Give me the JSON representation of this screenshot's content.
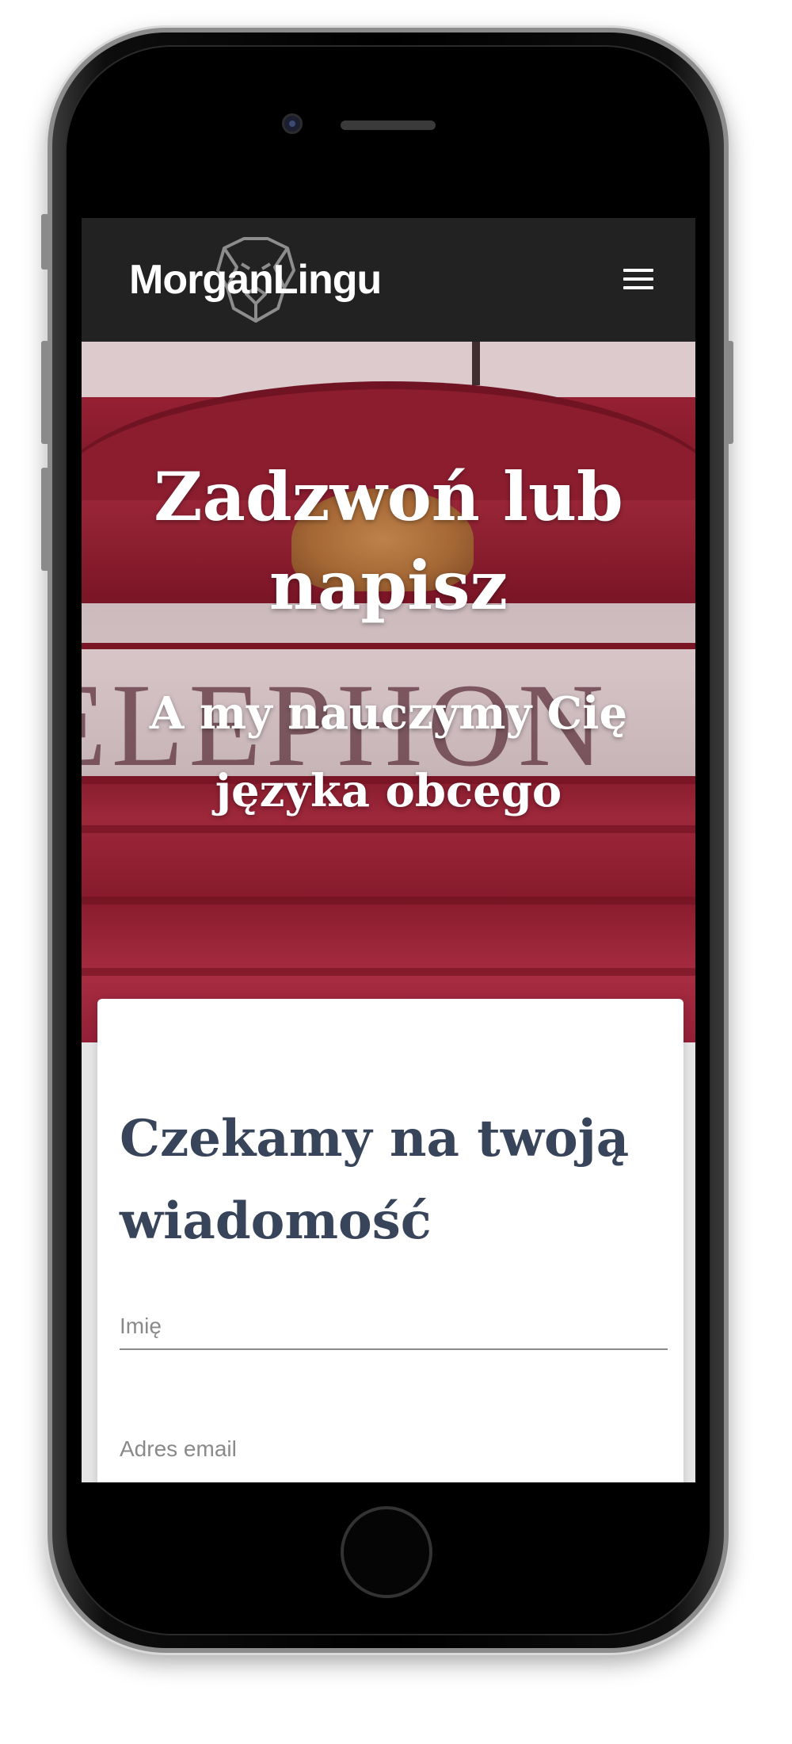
{
  "header": {
    "logo_text": "MorganLingu",
    "menu_icon": "hamburger-menu-icon"
  },
  "hero": {
    "title": "Zadzwoń lub napisz",
    "subtitle": "A my nauczymy Cię języka obcego",
    "background_sign_text": "ELEPHON",
    "accent_color": "#9b2336"
  },
  "contact_form": {
    "title": "Czekamy na twoją wiadomość",
    "name_placeholder": "Imię",
    "email_placeholder": "Adres email",
    "title_color": "#37445a"
  },
  "device": {
    "type": "iphone-mockup"
  }
}
